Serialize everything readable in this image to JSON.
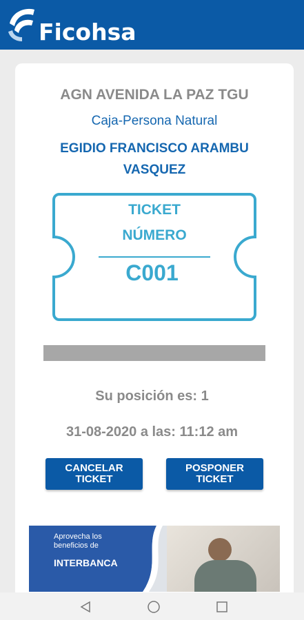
{
  "app": {
    "brand": "Ficohsa"
  },
  "ticket_card": {
    "agency": "AGN AVENIDA LA PAZ TGU",
    "service": "Caja-Persona Natural",
    "person_line1": "EGIDIO FRANCISCO ARAMBU",
    "person_line2": "VASQUEZ",
    "ticket_label_line1": "TICKET",
    "ticket_label_line2": "NÚMERO",
    "ticket_number": "C001",
    "progress": 0,
    "position": "Su posición es: 1",
    "datetime": "31-08-2020 a las: 11:12 am",
    "buttons": {
      "cancel_line1": "CANCELAR",
      "cancel_line2": "TICKET",
      "postpone_line1": "POSPONER",
      "postpone_line2": "TICKET"
    }
  },
  "banner": {
    "line1": "Aprovecha los",
    "line2": "beneficios de",
    "brand": "INTERBANCA"
  },
  "navbar": {
    "icons": [
      "back-icon",
      "home-icon",
      "recents-icon"
    ]
  },
  "colors": {
    "primary": "#0b5aa6",
    "ticket": "#3aa9cf",
    "muted": "#8a8a8a"
  }
}
